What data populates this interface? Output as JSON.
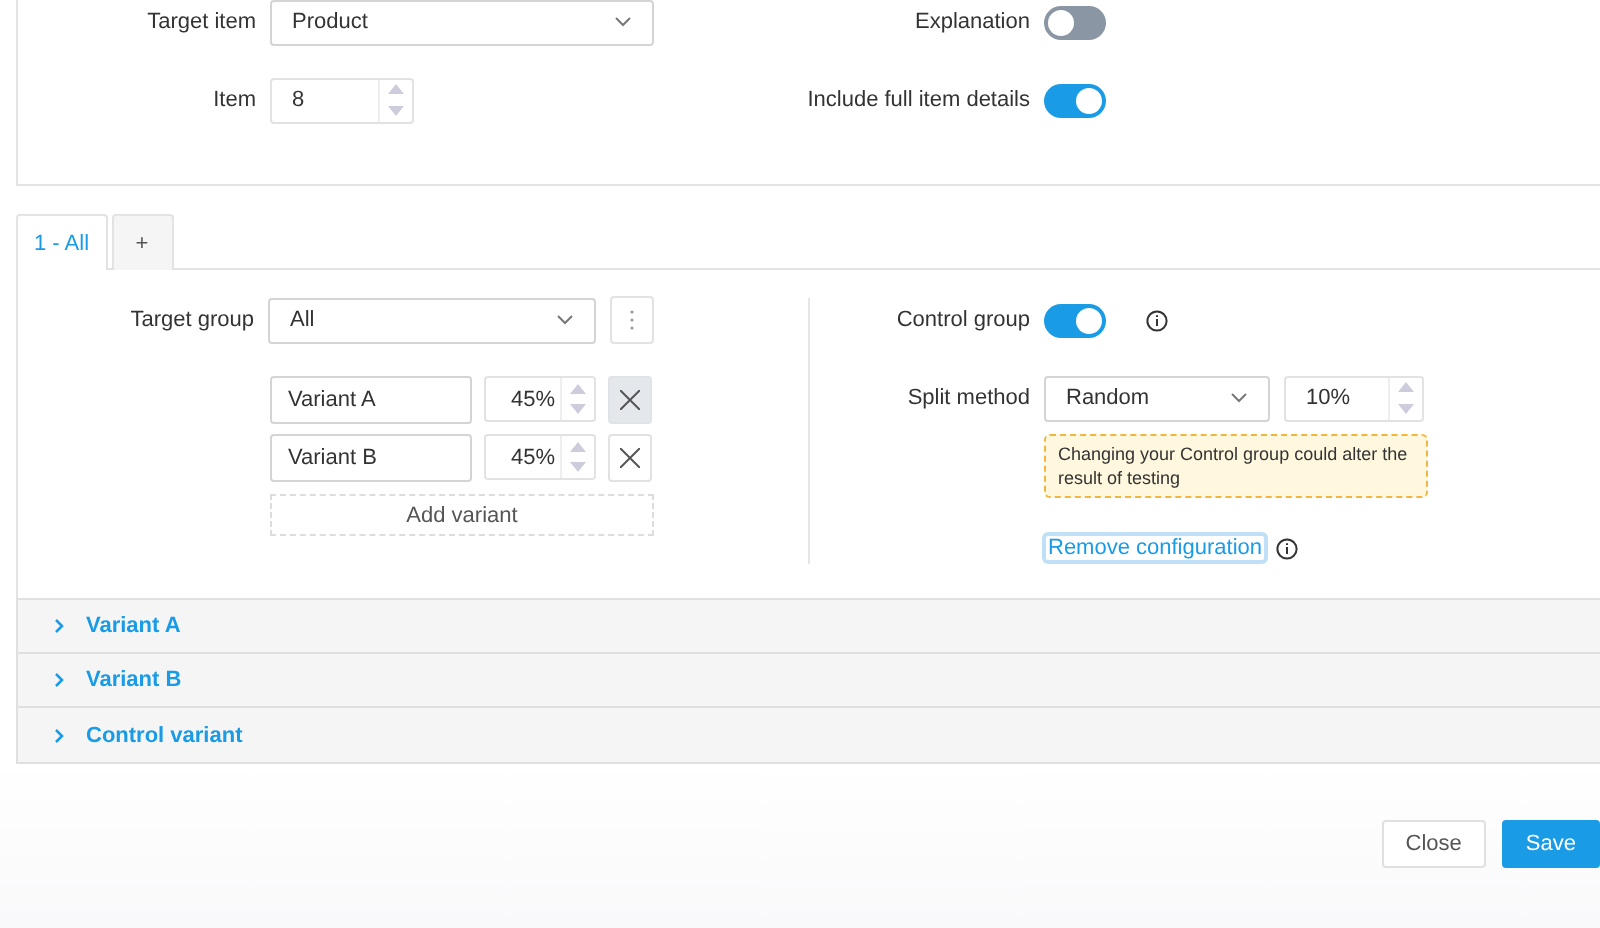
{
  "settings": {
    "target_item": {
      "label": "Target item",
      "value": "Product"
    },
    "item": {
      "label": "Item",
      "value": "8"
    },
    "explanation": {
      "label": "Explanation",
      "on": false
    },
    "full_details": {
      "label": "Include full item details",
      "on": true
    }
  },
  "tabs": [
    {
      "label": "1 - All",
      "selected": true
    },
    {
      "label": "+",
      "selected": false
    }
  ],
  "group": {
    "target_group": {
      "label": "Target group",
      "value": "All"
    },
    "variants": [
      {
        "name": "Variant A",
        "percent": "45%",
        "hovered": true
      },
      {
        "name": "Variant B",
        "percent": "45%",
        "hovered": false
      }
    ],
    "add_variant": "Add variant",
    "control_group": {
      "label": "Control group",
      "on": true
    },
    "split_method": {
      "label": "Split method",
      "value": "Random",
      "percent": "10%"
    },
    "warning": "Changing your Control group could alter the result of testing",
    "remove_link": "Remove configuration"
  },
  "accordion": [
    {
      "label": "Variant A",
      "expanded": false
    },
    {
      "label": "Variant B",
      "expanded": false
    },
    {
      "label": "Control variant",
      "expanded": false
    }
  ],
  "buttons": {
    "close": "Close",
    "save": "Save"
  }
}
